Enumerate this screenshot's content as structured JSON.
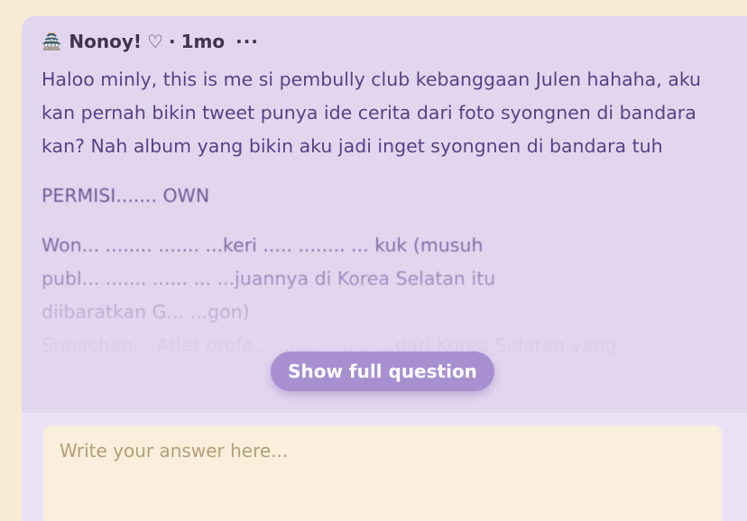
{
  "question": {
    "icon": "pagoda-icon",
    "author": "Nonoy!",
    "heart": "♡",
    "separator": "·",
    "time": "1mo",
    "more": "···",
    "paragraphs": [
      "Haloo minly, this is me si pembully club kebanggaan Julen hahaha, aku kan pernah bikin tweet punya ide cerita dari foto syongnen di bandara kan? Nah album yang bikin aku jadi inget syongnen di bandara tuh"
    ],
    "faded_lines": [
      "PERMISI....... OWN",
      "Won... ........ ....... ...keri ..... ........ ... kuk (musuh",
      "publ... ....... ...... ... ...juannya di Korea Selatan itu",
      "diibaratkan G... ...gon)",
      "Sunachan... Atlet profe... ....... ........ ...dari Korea Selatan yang"
    ],
    "show_full_label": "Show full question"
  },
  "answer": {
    "placeholder": "Write your answer here..."
  },
  "colors": {
    "page_bg": "#f7ecd3",
    "card_bg": "#e2d6ef",
    "text": "#5b3f86",
    "button_bg": "#a88fd0",
    "answer_bg": "#f9efdc"
  }
}
